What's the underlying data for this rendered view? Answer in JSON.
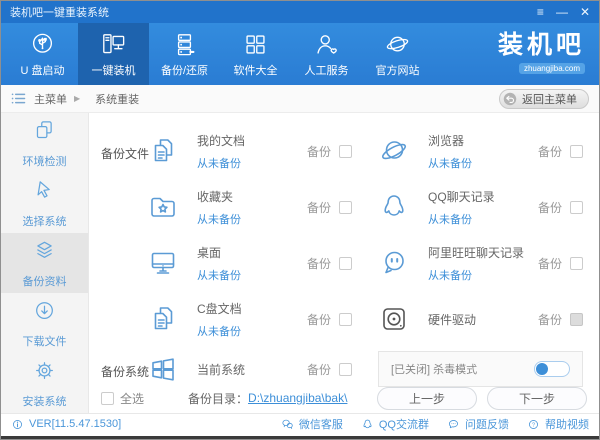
{
  "window": {
    "title": "装机吧一键重装系统",
    "controls": {
      "menu": "≡",
      "minimize": "—",
      "close": "✕"
    }
  },
  "nav": {
    "items": [
      {
        "label": "U 盘启动",
        "icon": "usb-boot-icon"
      },
      {
        "label": "一键装机",
        "icon": "one-key-install-icon"
      },
      {
        "label": "备份/还原",
        "icon": "backup-restore-icon"
      },
      {
        "label": "软件大全",
        "icon": "software-grid-icon"
      },
      {
        "label": "人工服务",
        "icon": "support-person-icon"
      },
      {
        "label": "官方网站",
        "icon": "official-site-icon"
      }
    ],
    "logo": {
      "text": "装机吧",
      "domain": "zhuangjiba.com"
    }
  },
  "breadcrumb": {
    "root": "主菜单",
    "separator": "▶",
    "current": "系统重装",
    "back_button": "返回主菜单"
  },
  "sidebar": {
    "items": [
      {
        "label": "环境检测"
      },
      {
        "label": "选择系统"
      },
      {
        "label": "备份资料"
      },
      {
        "label": "下载文件"
      },
      {
        "label": "安装系统"
      }
    ]
  },
  "main": {
    "backup_files_label": "备份文件",
    "backup_system_label": "备份系统",
    "backup_label": "备份",
    "items_left": [
      {
        "title": "我的文档",
        "status": "从未备份"
      },
      {
        "title": "收藏夹",
        "status": "从未备份"
      },
      {
        "title": "桌面",
        "status": "从未备份"
      },
      {
        "title": "C盘文档",
        "status": "从未备份"
      }
    ],
    "items_right": [
      {
        "title": "浏览器",
        "status": "从未备份"
      },
      {
        "title": "QQ聊天记录",
        "status": "从未备份"
      },
      {
        "title": "阿里旺旺聊天记录",
        "status": "从未备份"
      },
      {
        "title": "硬件驱动",
        "status": ""
      }
    ],
    "system_item": {
      "title": "当前系统"
    },
    "antivirus": {
      "label": "[已关闭] 杀毒模式",
      "state": "off"
    },
    "select_all_label": "全选",
    "backup_dir_label": "备份目录：",
    "backup_dir_path": "D:\\zhuangjiba\\bak\\",
    "prev_button": "上一步",
    "next_button": "下一步"
  },
  "statusbar": {
    "version": "VER[11.5.47.1530]",
    "links": [
      {
        "label": "微信客服",
        "icon": "wechat-icon"
      },
      {
        "label": "QQ交流群",
        "icon": "qq-group-icon"
      },
      {
        "label": "问题反馈",
        "icon": "feedback-icon"
      },
      {
        "label": "帮助视频",
        "icon": "help-video-icon"
      }
    ]
  },
  "colors": {
    "titlebar": "#2173cb",
    "nav": "#2e82d6",
    "nav_active": "#1e63ae",
    "accent": "#5b9bd5",
    "link": "#3d8fd8"
  }
}
